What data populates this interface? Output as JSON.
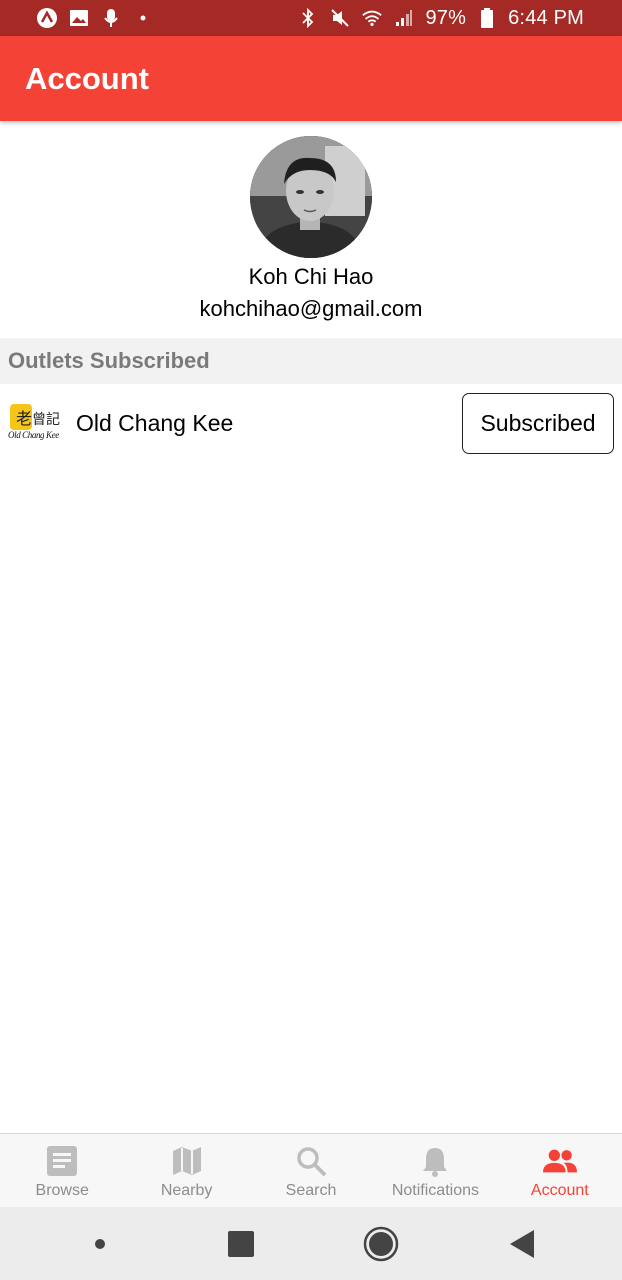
{
  "status_bar": {
    "battery": "97%",
    "time": "6:44 PM",
    "icons": [
      "app-icon",
      "image-icon",
      "mic-icon",
      "dot-icon",
      "bluetooth-icon",
      "mute-icon",
      "wifi-icon",
      "signal-icon",
      "battery-icon"
    ]
  },
  "header": {
    "title": "Account"
  },
  "profile": {
    "name": "Koh Chi Hao",
    "email": "kohchihao@gmail.com"
  },
  "outlets": {
    "section_title": "Outlets Subscribed",
    "items": [
      {
        "name": "Old Chang Kee",
        "button_label": "Subscribed",
        "logo_caption": "Old Chang Kee"
      }
    ]
  },
  "tabs": [
    {
      "label": "Browse",
      "icon": "browse-icon",
      "active": false
    },
    {
      "label": "Nearby",
      "icon": "map-icon",
      "active": false
    },
    {
      "label": "Search",
      "icon": "search-icon",
      "active": false
    },
    {
      "label": "Notifications",
      "icon": "bell-icon",
      "active": false
    },
    {
      "label": "Account",
      "icon": "people-icon",
      "active": true
    }
  ],
  "colors": {
    "status_bar": "#a52a26",
    "app_bar": "#f44336",
    "active_tab": "#f44336",
    "inactive_tab": "#8c8c8c"
  }
}
